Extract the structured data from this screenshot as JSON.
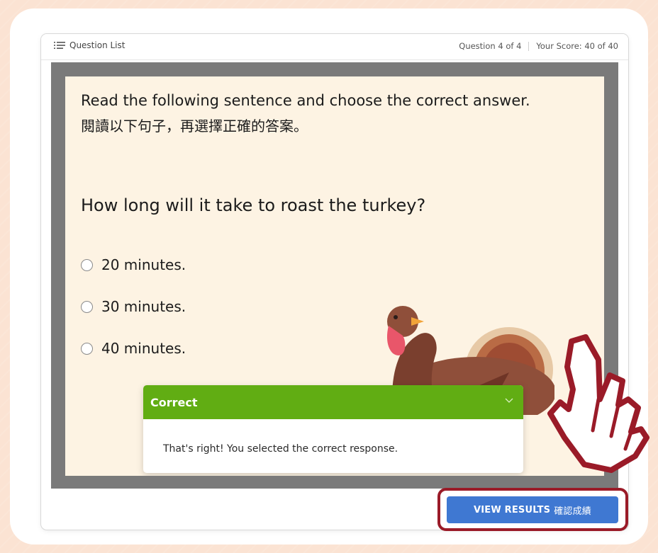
{
  "toolbar": {
    "question_list_label": "Question List",
    "question_counter": "Question 4 of 4",
    "score": "Your Score: 40 of 40"
  },
  "slide": {
    "instruction_en": "Read the following sentence and choose the correct answer.",
    "instruction_zh": "閱讀以下句子，再選擇正確的答案。",
    "question": "How long will it take to roast the turkey?",
    "options": [
      {
        "label": "20 minutes."
      },
      {
        "label": "30 minutes."
      },
      {
        "label": "40 minutes."
      }
    ]
  },
  "feedback": {
    "title": "Correct",
    "message": "That's right! You selected the correct response.",
    "header_color": "#61ad13"
  },
  "result_button": {
    "label_en": "VIEW RESULTS",
    "label_zh": "確認成績",
    "color": "#3f78d2",
    "highlight_color": "#9a1b28"
  },
  "icons": {
    "question_list": "list-icon",
    "feedback_toggle": "chevron-down-icon",
    "pointer": "hand-pointer-icon",
    "illustration": "turkey-illustration"
  }
}
